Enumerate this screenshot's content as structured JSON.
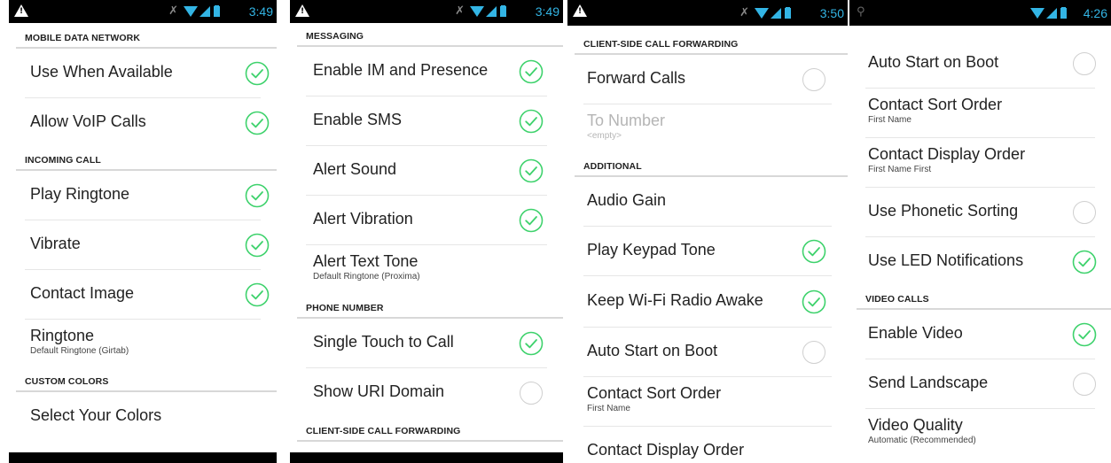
{
  "colors": {
    "accent": "#3ed26c",
    "statusbar": "#000000",
    "status_icons": "#33b5e5"
  },
  "screens": [
    {
      "time": "3:49",
      "rows": [
        {
          "type": "header",
          "label": "MOBILE DATA NETWORK"
        },
        {
          "type": "item",
          "title": "Use When Available",
          "checked": true
        },
        {
          "type": "item",
          "title": "Allow VoIP Calls",
          "checked": true
        },
        {
          "type": "header",
          "label": "INCOMING CALL"
        },
        {
          "type": "item",
          "title": "Play Ringtone",
          "checked": true
        },
        {
          "type": "item",
          "title": "Vibrate",
          "checked": true
        },
        {
          "type": "item",
          "title": "Contact Image",
          "checked": true
        },
        {
          "type": "item",
          "title": "Ringtone",
          "subtitle": "Default Ringtone (Girtab)"
        },
        {
          "type": "header",
          "label": "CUSTOM COLORS"
        },
        {
          "type": "item",
          "title": "Select Your Colors"
        }
      ]
    },
    {
      "time": "3:49",
      "rows": [
        {
          "type": "header",
          "label": "MESSAGING"
        },
        {
          "type": "item",
          "title": "Enable IM and Presence",
          "checked": true
        },
        {
          "type": "item",
          "title": "Enable SMS",
          "checked": true
        },
        {
          "type": "item",
          "title": "Alert Sound",
          "checked": true
        },
        {
          "type": "item",
          "title": "Alert Vibration",
          "checked": true
        },
        {
          "type": "item",
          "title": "Alert Text Tone",
          "subtitle": "Default Ringtone (Proxima)"
        },
        {
          "type": "header",
          "label": "PHONE NUMBER"
        },
        {
          "type": "item",
          "title": "Single Touch to Call",
          "checked": true
        },
        {
          "type": "item",
          "title": "Show URI Domain",
          "checked": false
        },
        {
          "type": "header",
          "label": "CLIENT-SIDE CALL FORWARDING"
        }
      ]
    },
    {
      "time": "3:50",
      "rows": [
        {
          "type": "header",
          "label": "CLIENT-SIDE CALL FORWARDING"
        },
        {
          "type": "item",
          "title": "Forward Calls",
          "checked": false
        },
        {
          "type": "item",
          "title": "To Number",
          "subtitle": "<empty>",
          "disabled": true
        },
        {
          "type": "header",
          "label": "ADDITIONAL"
        },
        {
          "type": "item",
          "title": "Audio Gain"
        },
        {
          "type": "item",
          "title": "Play Keypad Tone",
          "checked": true
        },
        {
          "type": "item",
          "title": "Keep Wi-Fi Radio Awake",
          "checked": true
        },
        {
          "type": "item",
          "title": "Auto Start on Boot",
          "checked": false
        },
        {
          "type": "item",
          "title": "Contact Sort Order",
          "subtitle": "First Name"
        },
        {
          "type": "item",
          "title": "Contact Display Order"
        }
      ]
    },
    {
      "time": "4:26",
      "rows": [
        {
          "type": "item",
          "title": "Auto Start on Boot",
          "checked": false
        },
        {
          "type": "item",
          "title": "Contact Sort Order",
          "subtitle": "First Name"
        },
        {
          "type": "item",
          "title": "Contact Display Order",
          "subtitle": "First Name First"
        },
        {
          "type": "item",
          "title": "Use Phonetic Sorting",
          "checked": false
        },
        {
          "type": "item",
          "title": "Use LED Notifications",
          "checked": true
        },
        {
          "type": "header",
          "label": "VIDEO CALLS"
        },
        {
          "type": "item",
          "title": "Enable Video",
          "checked": true
        },
        {
          "type": "item",
          "title": "Send Landscape",
          "checked": false
        },
        {
          "type": "item",
          "title": "Video Quality",
          "subtitle": "Automatic (Recommended)"
        }
      ]
    }
  ]
}
